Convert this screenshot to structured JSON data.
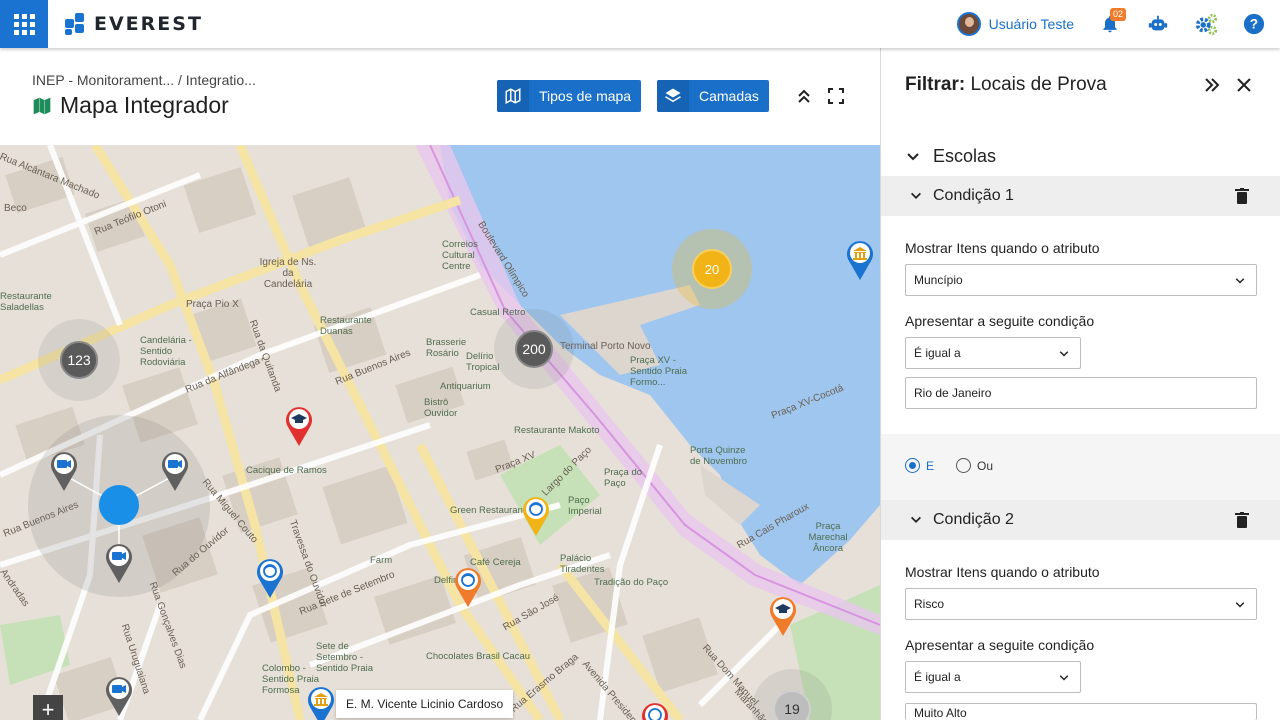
{
  "brand": {
    "name": "EVEREST"
  },
  "user": {
    "name": "Usuário Teste",
    "notifications_count": "02"
  },
  "topbar_icons": [
    "apps-grid-icon",
    "bell-icon",
    "robot-icon",
    "gears-icon",
    "help-icon"
  ],
  "header": {
    "breadcrumb": "INEP - Monitorament... / Integratio...",
    "title": "Mapa Integrador",
    "map_types_label": "Tipos de mapa",
    "layers_label": "Camadas"
  },
  "map": {
    "clusters": [
      {
        "count": "123"
      },
      {
        "count": "200"
      },
      {
        "count": "20"
      },
      {
        "count": "19"
      }
    ],
    "tooltip": "E. M. Vicente Licinio Cardoso",
    "zoom_in_label": "+",
    "streets": [
      "Rua Alcântara Machado",
      "Beco",
      "Rua Teófilo Otoni",
      "Igreja de Ns. da Candelária",
      "Praça Pio X",
      "Rua da Quitanda",
      "Correios Cultural Centre",
      "Boulevard Olímpico",
      "Restaurante Saladellas",
      "Candelária - Sentido Rodoviária",
      "Rua da Alfândega",
      "Restaurante Duanas",
      "Casual Retro",
      "Brasserie Rosário",
      "Delírio Tropical",
      "Rua Buenos Aires",
      "Terminal Porto Novo",
      "Praça XV - Sentido Praia Formo...",
      "Antiquarium",
      "Bistrô Ouvidor",
      "Restaurante Makoto",
      "Cacique de Ramos",
      "Praça XV",
      "Largo do Paço",
      "Praça do Paço",
      "Praça XV-Cocotá",
      "Porta Quinze de Novembro",
      "Green Restaurante",
      "Paço Imperial",
      "Rua Buenos Aires",
      "Rua Miguel Couto",
      "Travessa do Ouvidor",
      "Rua do Ouvidor",
      "Rua Gonçalves Dias",
      "Rua Uruguaiana",
      "Rua Sete de Setembro",
      "Farm",
      "Café Cereja",
      "Palácio Tiradentes",
      "Rua São José",
      "Sete de Setembro - Sentido Praia",
      "Colombo - Sentido Praia Formosa",
      "Chocolates Brasil Cacau",
      "Rua Erasmo Braga",
      "Avenida Presidente",
      "Rua Dom Manuel",
      "Rua Cais Pharoux",
      "Praça Marechal Âncora",
      "Andradas",
      "Tradição do Paço",
      "Delfim",
      "Maranhão"
    ]
  },
  "panel": {
    "title_prefix": "Filtrar:",
    "title_value": "Locais de Prova",
    "section": "Escolas",
    "conditions": [
      {
        "label": "Condição 1",
        "attribute_label": "Mostrar Itens quando o atributo",
        "attribute_value": "Muncípio",
        "condition_label": "Apresentar a seguite condição",
        "condition_value": "É igual a",
        "value": "Rio de Janeiro"
      },
      {
        "label": "Condição 2",
        "attribute_label": "Mostrar Itens quando o atributo",
        "attribute_value": "Risco",
        "condition_label": "Apresentar a seguite condição",
        "condition_value": "É igual a",
        "value": "Muito Alto"
      }
    ],
    "logic": {
      "and_label": "E",
      "or_label": "Ou",
      "selected": "E"
    }
  },
  "colors": {
    "primary": "#1a6fc9",
    "pin_red": "#e0312e",
    "pin_orange": "#f07b2a",
    "pin_yellow": "#f2b316",
    "pin_blue": "#1a73d1",
    "pin_gray": "#606060",
    "cluster_gray": "#5a5a5a",
    "cluster_yellow": "#f2b316",
    "water": "#9ec6ee",
    "park": "#c6e1b7"
  }
}
